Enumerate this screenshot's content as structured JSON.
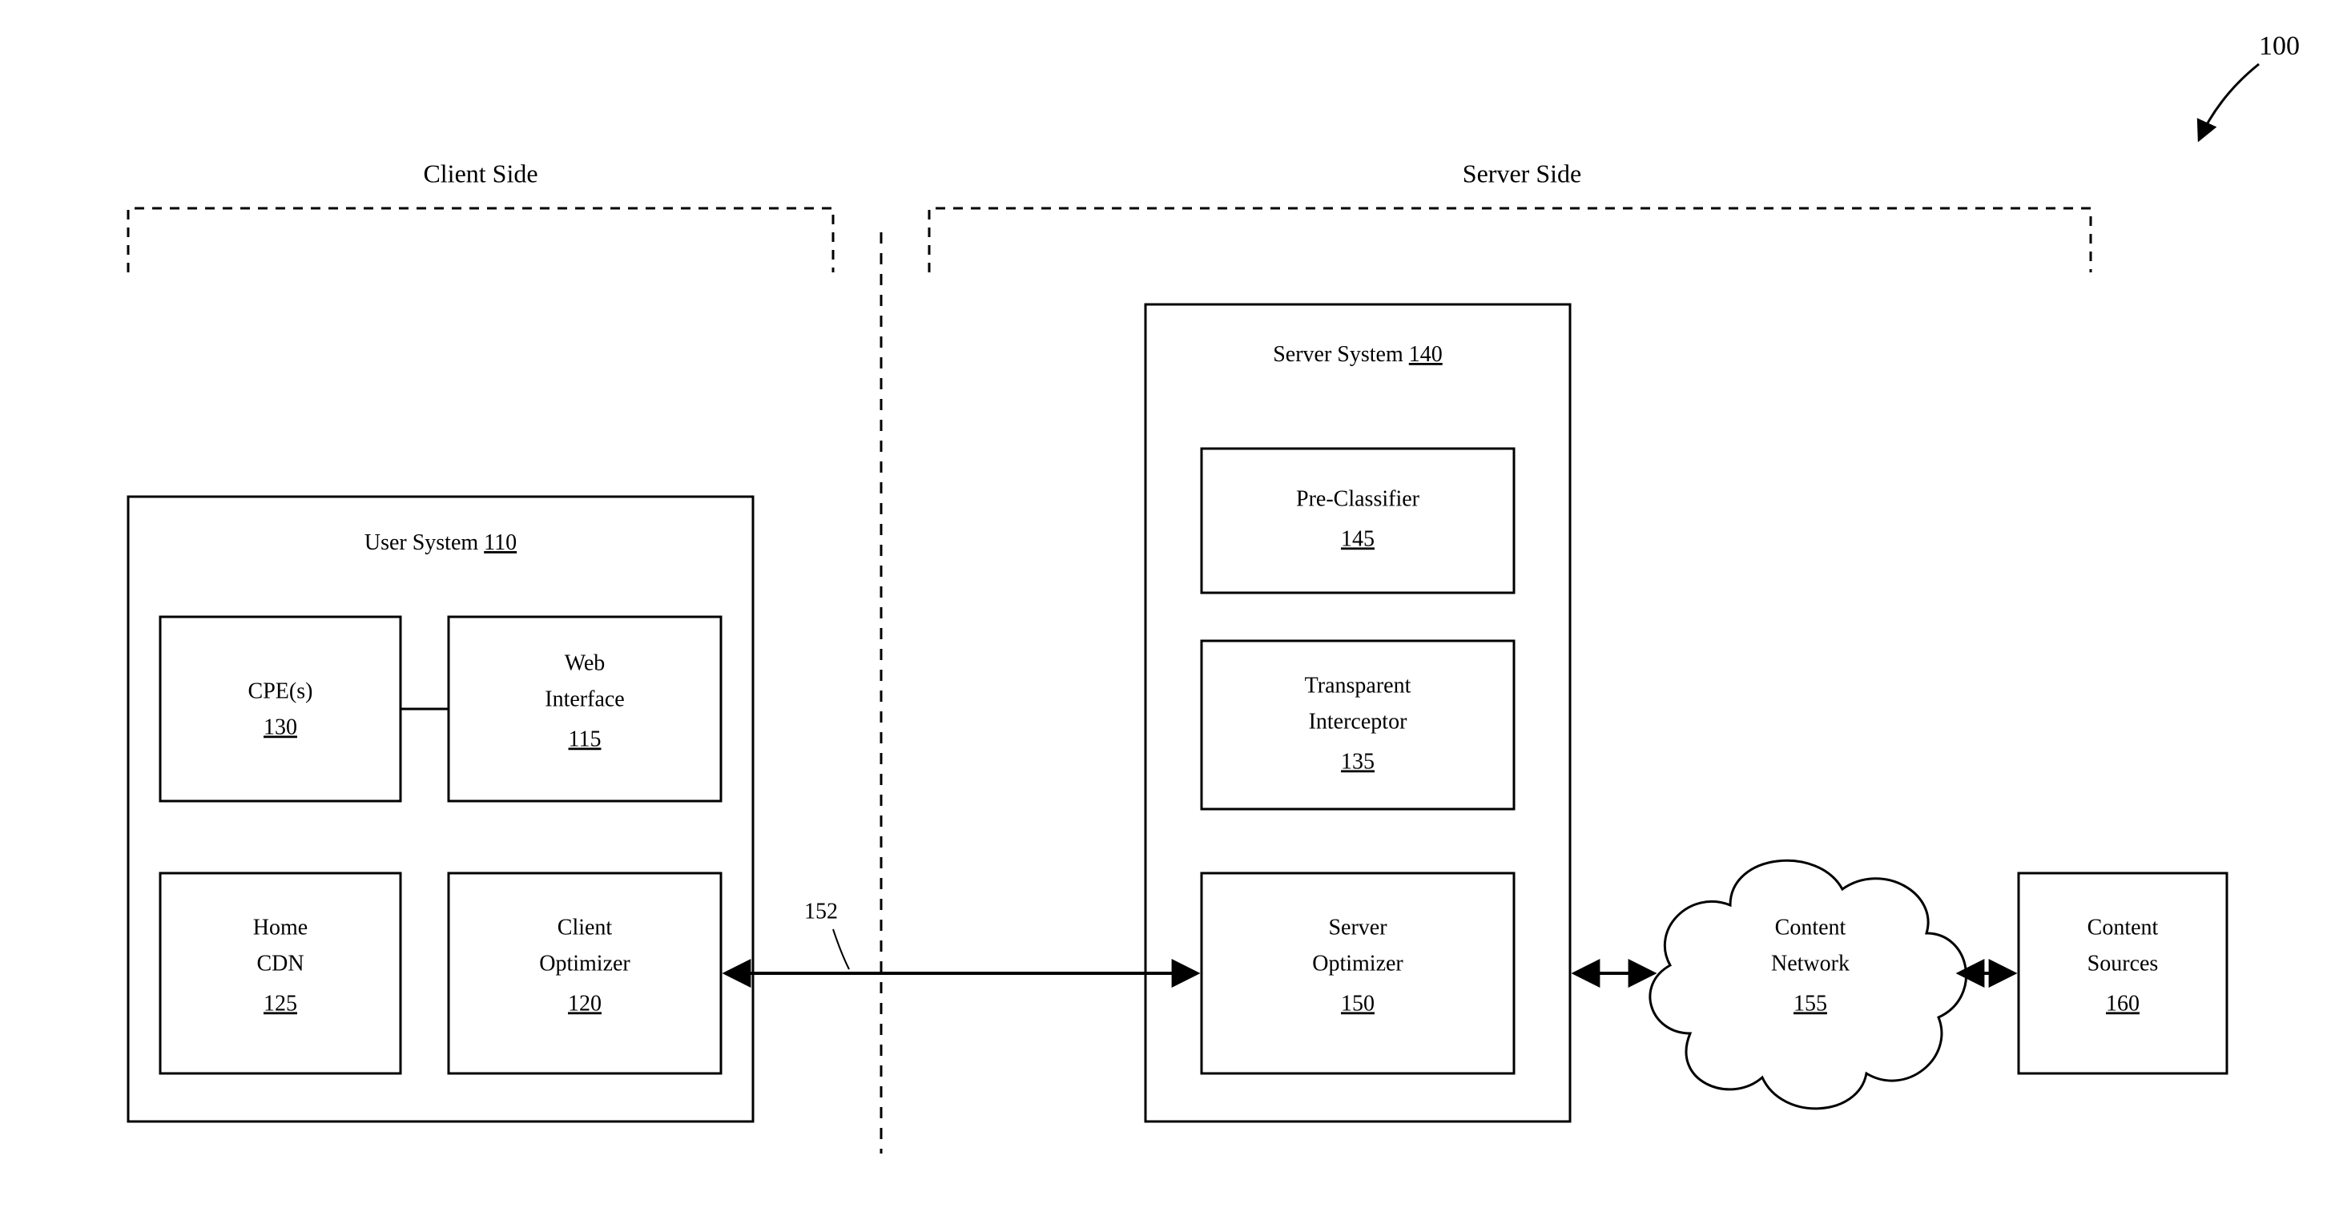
{
  "figure": {
    "number": "100"
  },
  "sections": {
    "client": {
      "label": "Client Side"
    },
    "server": {
      "label": "Server Side"
    }
  },
  "link_label": "152",
  "user_system": {
    "title": "User System",
    "ref": "110",
    "cpe": {
      "label": "CPE(s)",
      "ref": "130"
    },
    "web_interface": {
      "label1": "Web",
      "label2": "Interface",
      "ref": "115"
    },
    "home_cdn": {
      "label1": "Home",
      "label2": "CDN",
      "ref": "125"
    },
    "client_optimizer": {
      "label1": "Client",
      "label2": "Optimizer",
      "ref": "120"
    }
  },
  "server_system": {
    "title": "Server System",
    "ref": "140",
    "pre_classifier": {
      "label": "Pre-Classifier",
      "ref": "145"
    },
    "transparent_interceptor": {
      "label1": "Transparent",
      "label2": "Interceptor",
      "ref": "135"
    },
    "server_optimizer": {
      "label1": "Server",
      "label2": "Optimizer",
      "ref": "150"
    }
  },
  "content_network": {
    "label1": "Content",
    "label2": "Network",
    "ref": "155"
  },
  "content_sources": {
    "label1": "Content",
    "label2": "Sources",
    "ref": "160"
  }
}
